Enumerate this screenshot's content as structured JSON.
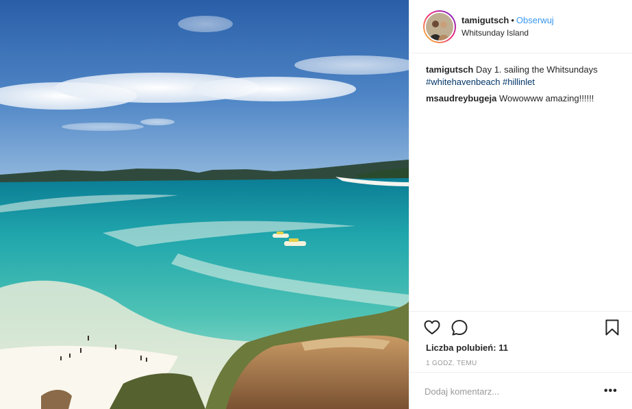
{
  "header": {
    "username": "tamigutsch",
    "separator": "•",
    "follow_label": "Obserwuj",
    "location": "Whitsunday Island"
  },
  "caption": {
    "username": "tamigutsch",
    "text": "Day 1. sailing the Whitsundays",
    "hashtags": [
      "#whitehavenbeach",
      "#hillinlet"
    ]
  },
  "comments": [
    {
      "username": "msaudreybugeja",
      "text": "Wowowww amazing!!!!!!"
    }
  ],
  "icons": {
    "like": "heart-icon",
    "comment": "speech-bubble-icon",
    "save": "bookmark-icon",
    "more": "more-options-icon"
  },
  "likes": {
    "label": "Liczba polubień:",
    "count": "11"
  },
  "timestamp": "1 GODZ. TEMU",
  "add_comment": {
    "placeholder": "Dodaj komentarz...",
    "more_label": "•••"
  },
  "colors": {
    "link": "#3897f0",
    "hashtag": "#003569",
    "muted": "#999999"
  }
}
